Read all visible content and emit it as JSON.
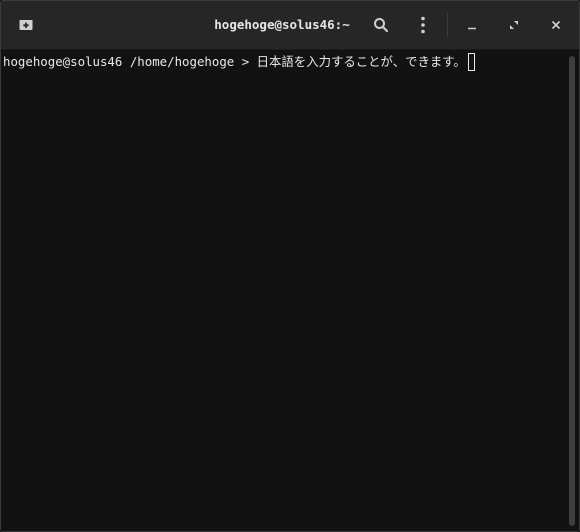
{
  "window": {
    "title": "hogehoge@solus46:~"
  },
  "icons": {
    "new_tab": "new-tab-icon",
    "search": "search-icon",
    "menu": "kebab-menu-icon",
    "minimize": "minimize-icon",
    "maximize": "maximize-icon",
    "close": "close-icon"
  },
  "terminal": {
    "prompt": "hogehoge@solus46 /home/hogehoge > ",
    "input": "日本語を入力することが、できます。"
  },
  "colors": {
    "titlebar": "#262626",
    "terminal_bg": "#121212",
    "text": "#e8e8e8"
  }
}
